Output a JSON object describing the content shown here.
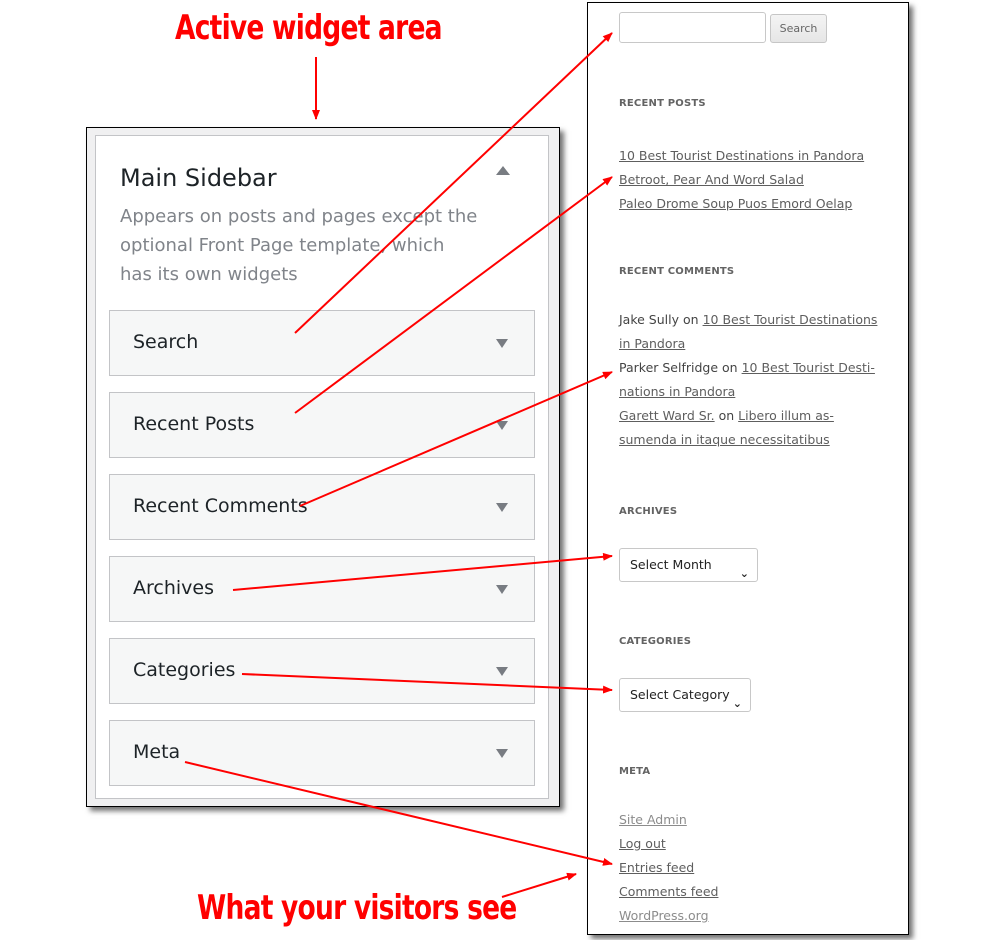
{
  "annotations": {
    "top_label": "Active widget area",
    "bottom_label": "What your visitors see",
    "color": "#ff0000"
  },
  "admin": {
    "sidebar_title": "Main Sidebar",
    "toggle_icon": "triangle-up-icon",
    "description": "Appears on posts and pages except the optional Front Page template, which has its own widgets",
    "widgets": [
      {
        "label": "Search",
        "caret_icon": "triangle-down-icon"
      },
      {
        "label": "Recent Posts",
        "caret_icon": "triangle-down-icon"
      },
      {
        "label": "Recent Comments",
        "caret_icon": "triangle-down-icon"
      },
      {
        "label": "Archives",
        "caret_icon": "triangle-down-icon"
      },
      {
        "label": "Categories",
        "caret_icon": "triangle-down-icon"
      },
      {
        "label": "Meta",
        "caret_icon": "triangle-down-icon"
      }
    ]
  },
  "frontend": {
    "search": {
      "input_value": "",
      "button_label": "Search"
    },
    "recent_posts": {
      "title": "RECENT POSTS",
      "items": [
        "10 Best Tourist Destinations in Pandora",
        "Betroot, Pear And Word Salad",
        "Paleo Drome Soup Puos Emord Oelap"
      ]
    },
    "recent_comments": {
      "title": "RECENT COMMENTS",
      "items": [
        {
          "author": "Jake Sully",
          "on": "on",
          "post_line1": "10 Best Tourist Destinations",
          "post_line2": "in Pandora"
        },
        {
          "author": "Parker Selfridge",
          "on": "on",
          "post_line1": "10 Best Tourist Desti-",
          "post_line2": "nations in Pandora"
        },
        {
          "author": "Garett Ward Sr.",
          "on": "on",
          "post_line1": "Libero illum as-",
          "post_line2": "sumenda in itaque necessitatibus"
        }
      ]
    },
    "archives": {
      "title": "ARCHIVES",
      "select_value": "Select Month"
    },
    "categories": {
      "title": "CATEGORIES",
      "select_value": "Select Category"
    },
    "meta": {
      "title": "META",
      "links": [
        "Site Admin",
        "Log out",
        "Entries feed",
        "Comments feed",
        "WordPress.org"
      ]
    }
  }
}
